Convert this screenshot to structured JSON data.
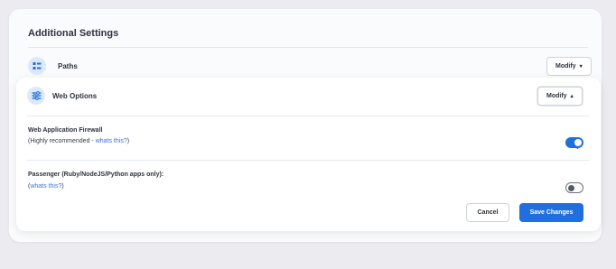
{
  "section": {
    "title": "Additional Settings"
  },
  "paths": {
    "label": "Paths",
    "modify_label": "Modify",
    "caret": "▾",
    "icon": "paths-icon"
  },
  "web_options": {
    "label": "Web Options",
    "modify_label": "Modify",
    "caret": "▴",
    "icon": "sliders-icon",
    "settings": [
      {
        "title": "Web Application Firewall",
        "desc_prefix": "(Highly recommended - ",
        "link": "whats this?",
        "desc_suffix": ")",
        "enabled": true
      },
      {
        "title": "Passenger (Ruby/NodeJS/Python apps only):",
        "desc_prefix": "(",
        "link": "whats this?",
        "desc_suffix": ")",
        "enabled": false
      }
    ]
  },
  "actions": {
    "cancel_label": "Cancel",
    "save_label": "Save Changes"
  },
  "colors": {
    "accent": "#1f6fe0",
    "link": "#3b73d9",
    "icon_bg": "#dde9fb"
  }
}
